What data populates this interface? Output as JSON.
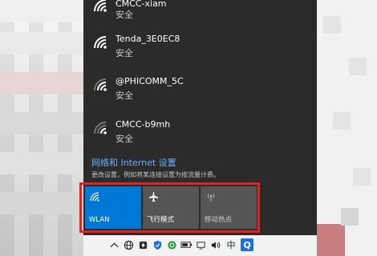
{
  "networks": [
    {
      "name": "CMCC-xiam",
      "status": "安全"
    },
    {
      "name": "Tenda_3E0EC8",
      "status": "安全"
    },
    {
      "name": "@PHICOMM_5C",
      "status": "安全"
    },
    {
      "name": "CMCC-b9mh",
      "status": "安全"
    }
  ],
  "settings": {
    "link_label": "网络和 Internet 设置",
    "description": "更改设置，例如将某连接设置为按流量计费。"
  },
  "quick_actions": [
    {
      "label": "WLAN",
      "active": true,
      "icon": "wifi-icon"
    },
    {
      "label": "飞行模式",
      "active": false,
      "icon": "airplane-icon"
    },
    {
      "label": "移动热点",
      "active": false,
      "icon": "hotspot-icon"
    }
  ],
  "taskbar": {
    "ime_label": "中",
    "search_icon_label": "Q"
  },
  "colors": {
    "accent": "#0078d7",
    "panel_bg": "#2b2b2b",
    "tile_inactive": "#555555",
    "link": "#6fb0ff",
    "highlight_box": "#e02424"
  }
}
